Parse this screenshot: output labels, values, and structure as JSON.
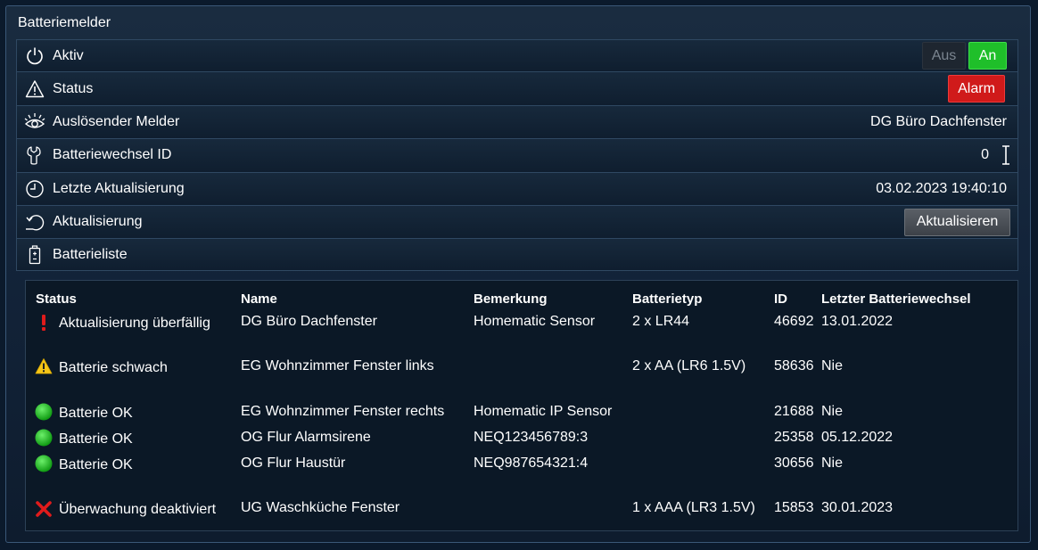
{
  "panel": {
    "title": "Batteriemelder"
  },
  "rows": {
    "aktiv": {
      "label": "Aktiv",
      "off_label": "Aus",
      "on_label": "An",
      "icon": "power-icon"
    },
    "status": {
      "label": "Status",
      "value": "Alarm",
      "icon": "warning-triangle-icon"
    },
    "trigger": {
      "label": "Auslösender Melder",
      "value": "DG Büro Dachfenster",
      "icon": "eye-icon"
    },
    "change_id": {
      "label": "Batteriewechsel ID",
      "value": "0",
      "icon": "wrench-icon"
    },
    "last_update": {
      "label": "Letzte Aktualisierung",
      "value": "03.02.2023 19:40:10",
      "icon": "clock-icon"
    },
    "refresh": {
      "label": "Aktualisierung",
      "button": "Aktualisieren",
      "icon": "refresh-icon"
    },
    "list": {
      "label": "Batterieliste",
      "icon": "battery-icon"
    }
  },
  "colors": {
    "on": "#1fbf2a",
    "alarm": "#d01a1a",
    "ok": "#22c51f",
    "warn": "#f5c518",
    "error": "#e01b1b"
  },
  "table": {
    "headers": [
      "Status",
      "Name",
      "Bemerkung",
      "Batterietyp",
      "ID",
      "Letzter Batteriewechsel"
    ],
    "rows": [
      {
        "status_icon": "exclamation-icon",
        "status": "Aktualisierung überfällig",
        "name": "DG Büro Dachfenster",
        "note": "Homematic Sensor",
        "type": "2 x LR44",
        "id": "46692",
        "last": "13.01.2022"
      },
      {
        "status_icon": "warning-icon",
        "status": "Batterie schwach",
        "name": "EG Wohnzimmer Fenster links",
        "note": "",
        "type": "2 x AA (LR6 1.5V)",
        "id": "58636",
        "last": "Nie"
      },
      {
        "status_icon": "ok-dot-icon",
        "status": "Batterie OK",
        "name": "EG Wohnzimmer Fenster rechts",
        "note": "Homematic IP Sensor",
        "type": "",
        "id": "21688",
        "last": "Nie"
      },
      {
        "status_icon": "ok-dot-icon",
        "status": "Batterie OK",
        "name": "OG Flur Alarmsirene",
        "note": "NEQ123456789:3",
        "type": "",
        "id": "25358",
        "last": "05.12.2022"
      },
      {
        "status_icon": "ok-dot-icon",
        "status": "Batterie OK",
        "name": "OG Flur Haustür",
        "note": "NEQ987654321:4",
        "type": "",
        "id": "30656",
        "last": "Nie"
      },
      {
        "status_icon": "cross-icon",
        "status": "Überwachung deaktiviert",
        "name": "UG Waschküche Fenster",
        "note": "",
        "type": "1 x AAA (LR3 1.5V)",
        "id": "15853",
        "last": "30.01.2023"
      }
    ]
  }
}
